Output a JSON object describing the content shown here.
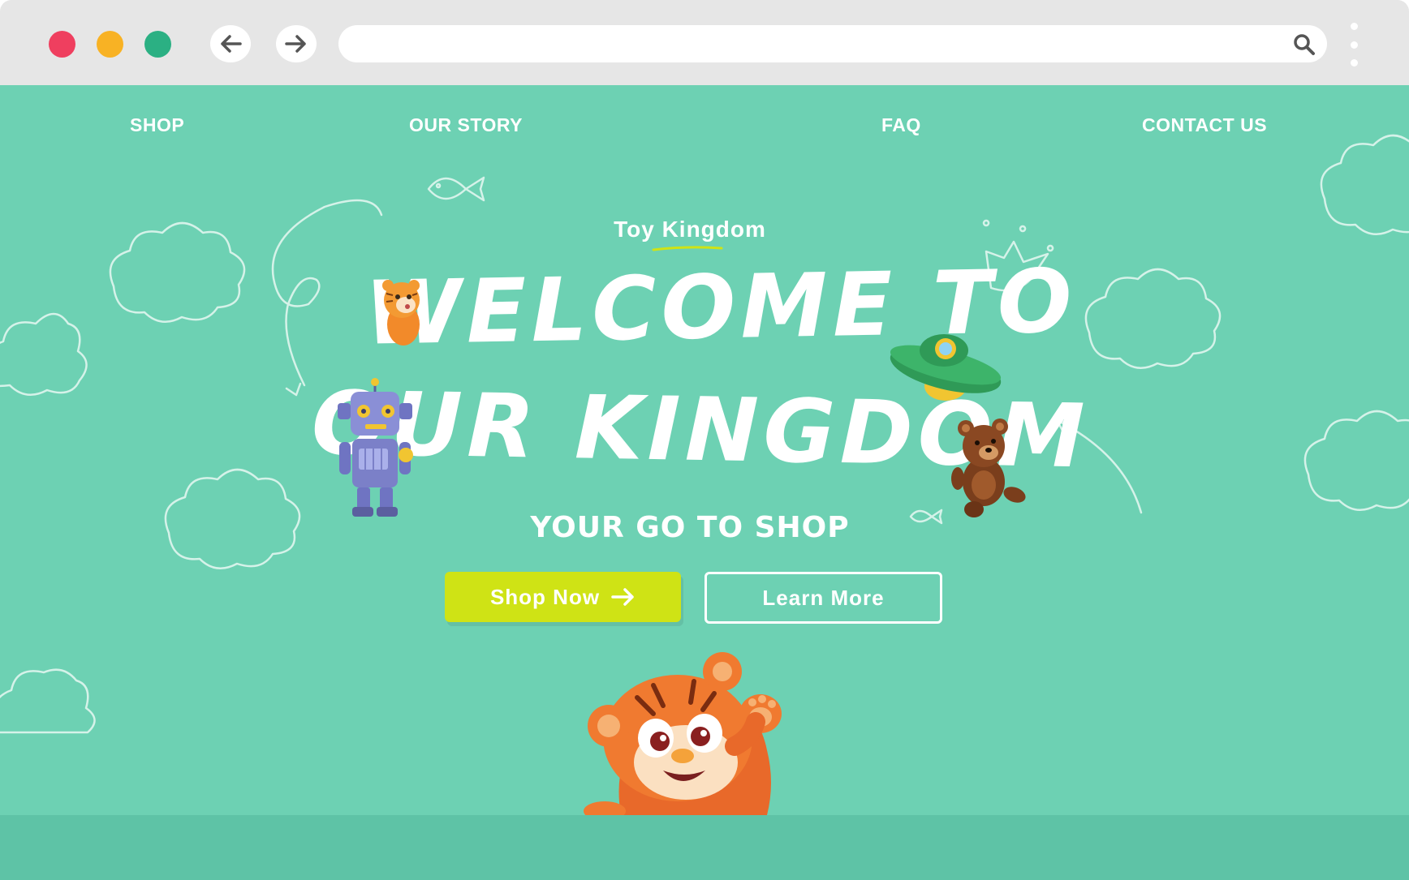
{
  "browser": {
    "back_icon": "arrow-left-icon",
    "forward_icon": "arrow-right-icon",
    "search_icon": "search-icon",
    "menu_icon": "kebab-menu-icon",
    "traffic_light_colors": [
      "#ef3f5f",
      "#f8b224",
      "#2bb083"
    ]
  },
  "nav": {
    "items": [
      {
        "label": "SHOP"
      },
      {
        "label": "OUR STORY"
      },
      {
        "label": "FAQ"
      },
      {
        "label": "CONTACT US"
      }
    ]
  },
  "hero": {
    "brand": "Toy Kingdom",
    "headline_line1": "WELCOME TO",
    "headline_line2": "OUR KINGDOM",
    "tagline": "YOUR GO TO SHOP",
    "shop_button": "Shop Now",
    "learn_button": "Learn More"
  },
  "colors": {
    "background": "#6dd1b3",
    "accent_button": "#cfe315",
    "text": "#ffffff",
    "footer_band": "#5ec3a6"
  },
  "illustrations": [
    "tiger-cub",
    "tiger-mascot",
    "toy-robot",
    "toy-ufo",
    "teddy-bear",
    "cloud-doodles",
    "crown-doodle",
    "fish-doodle",
    "arrow-doodles"
  ]
}
